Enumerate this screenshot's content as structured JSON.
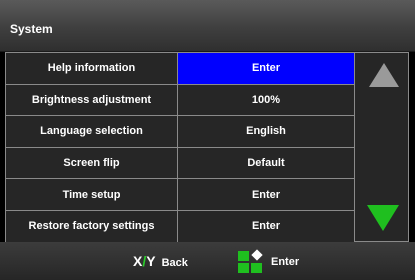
{
  "window": {
    "title": "System"
  },
  "menu": {
    "rows": [
      {
        "label": "Help information",
        "value": "Enter",
        "selected": true
      },
      {
        "label": "Brightness adjustment",
        "value": "100%",
        "selected": false
      },
      {
        "label": "Language selection",
        "value": "English",
        "selected": false
      },
      {
        "label": "Screen flip",
        "value": "Default",
        "selected": false
      },
      {
        "label": "Time setup",
        "value": "Enter",
        "selected": false
      },
      {
        "label": "Restore factory settings",
        "value": "Enter",
        "selected": false
      }
    ],
    "selected_color": "#0000ff"
  },
  "scroll": {
    "up_icon": "arrow-up",
    "down_icon": "arrow-down",
    "up_color": "#9a9a9a",
    "down_color": "#1fbf1f"
  },
  "footer": {
    "back_key_x": "X",
    "back_key_sep": "/",
    "back_key_y": "Y",
    "back_label": "Back",
    "enter_icon": "enter-squares-diamond",
    "enter_label": "Enter"
  }
}
